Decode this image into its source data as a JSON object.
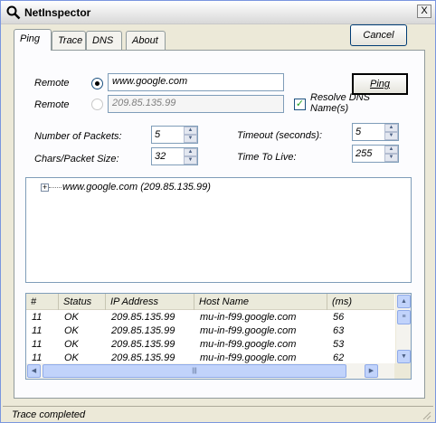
{
  "window": {
    "title": "NetInspector",
    "close_glyph": "X"
  },
  "tabs": [
    {
      "label": "Ping",
      "active": true
    },
    {
      "label": "Trace",
      "active": false
    },
    {
      "label": "DNS",
      "active": false
    },
    {
      "label": "About",
      "active": false
    }
  ],
  "buttons": {
    "cancel": "Cancel",
    "ping": "Ping"
  },
  "remote1": {
    "label": "Remote",
    "value": "www.google.com",
    "selected": true
  },
  "remote2": {
    "label": "Remote",
    "value": "209.85.135.99",
    "selected": false
  },
  "resolve_dns": {
    "label": "Resolve DNS Name(s)",
    "checked": true
  },
  "packets": {
    "label": "Number of Packets:",
    "value": "5"
  },
  "chars": {
    "label": "Chars/Packet Size:",
    "value": "32"
  },
  "timeout": {
    "label": "Timeout (seconds):",
    "value": "5"
  },
  "ttl": {
    "label": "Time To Live:",
    "value": "255"
  },
  "tree": {
    "expander": "+",
    "node": "www.google.com (209.85.135.99)"
  },
  "results": {
    "columns": [
      "#",
      "Status",
      "IP Address",
      "Host Name",
      "(ms)"
    ],
    "rows": [
      [
        "11",
        "OK",
        "209.85.135.99",
        "mu-in-f99.google.com",
        "56"
      ],
      [
        "11",
        "OK",
        "209.85.135.99",
        "mu-in-f99.google.com",
        "63"
      ],
      [
        "11",
        "OK",
        "209.85.135.99",
        "mu-in-f99.google.com",
        "53"
      ],
      [
        "11",
        "OK",
        "209.85.135.99",
        "mu-in-f99.google.com",
        "62"
      ]
    ]
  },
  "status": "Trace completed",
  "colors": {
    "window_bg": "#ece9d8",
    "panel_bg": "#fcfcfe",
    "border_blue": "#7f9db9"
  },
  "icons": [
    "magnifier-icon",
    "close-icon",
    "radio-icon",
    "checkbox-icon",
    "spin-up-icon",
    "spin-down-icon",
    "tree-expand-icon",
    "scroll-up-icon",
    "scroll-down-icon",
    "scroll-left-icon",
    "scroll-right-icon",
    "size-grip-icon"
  ]
}
